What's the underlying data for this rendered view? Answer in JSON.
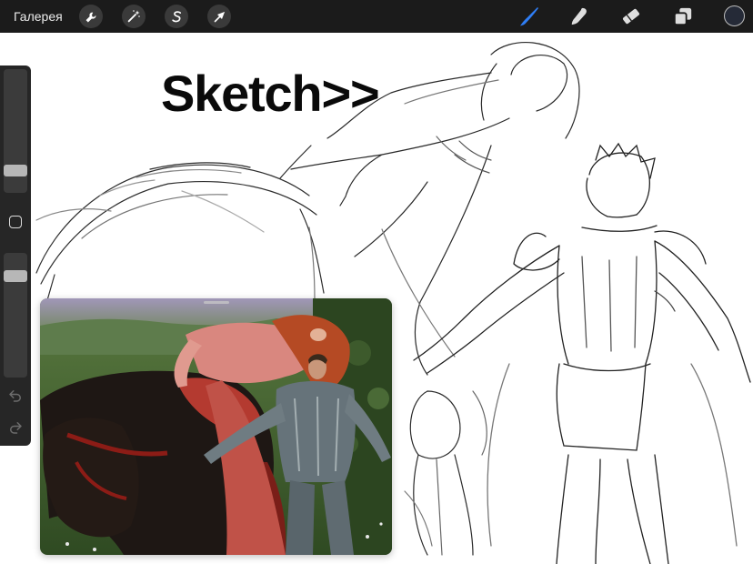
{
  "topbar": {
    "gallery_label": "Галерея",
    "left_tools": [
      "wrench-icon",
      "magic-wand-icon",
      "selection-icon",
      "transform-arrow-icon"
    ],
    "right_tools": [
      "brush-icon",
      "smudge-icon",
      "eraser-icon",
      "layers-icon"
    ],
    "active_tool": "brush-icon",
    "accent_color": "#2f7ef5",
    "current_color": "#252a37"
  },
  "canvas": {
    "heading": "Sketch>>"
  },
  "sidebar": {
    "brush_size": 0.15,
    "opacity": 0.85,
    "icons": [
      "modify-square-icon",
      "undo-icon",
      "redo-icon"
    ]
  }
}
